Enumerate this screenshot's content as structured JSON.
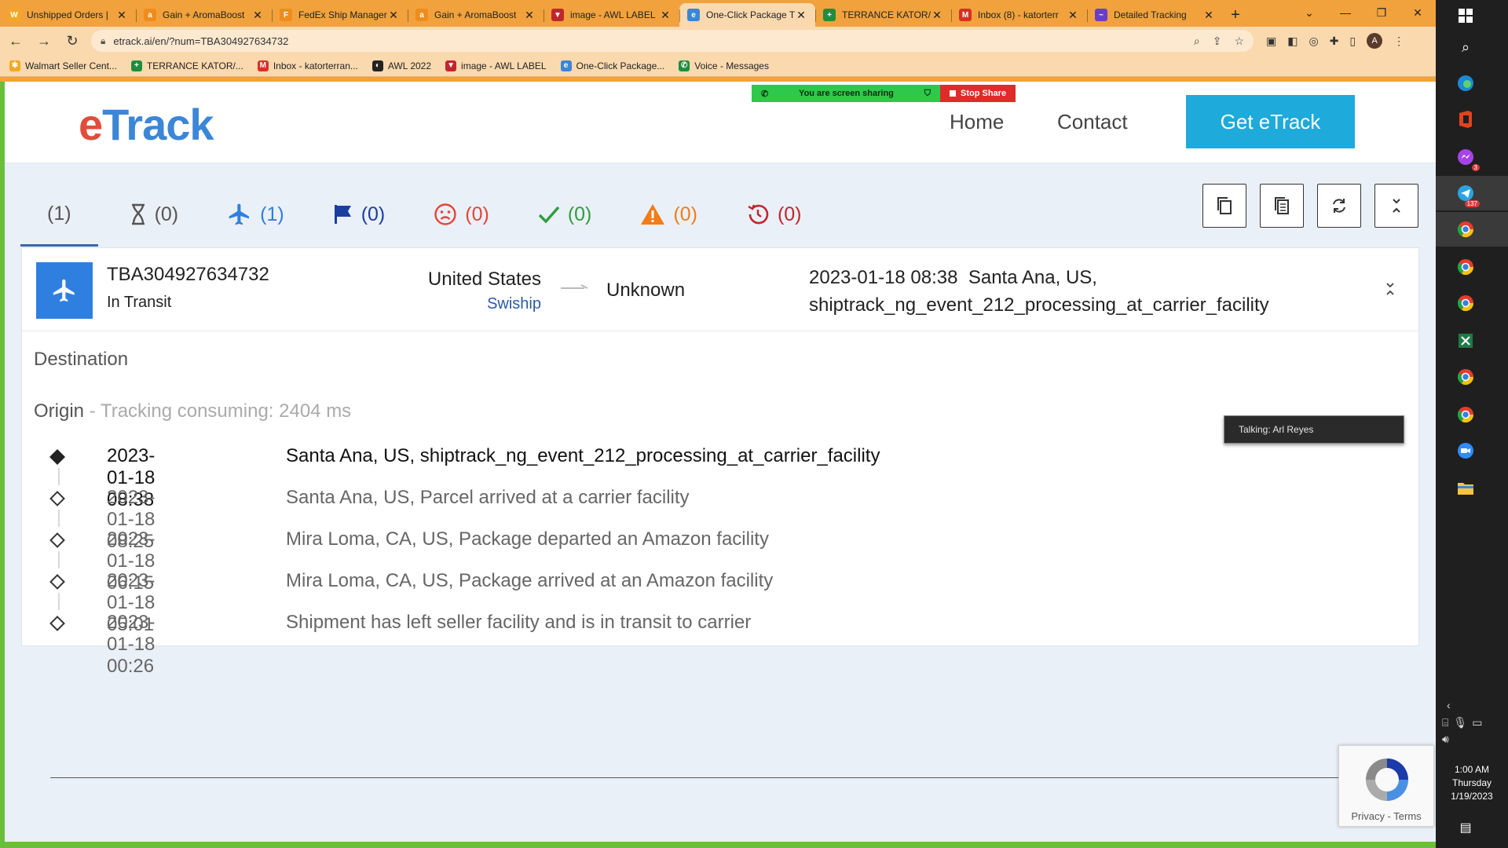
{
  "browser": {
    "tabs": [
      {
        "title": "Unshipped Orders |",
        "fav": "W",
        "fav_color": "#f5a623"
      },
      {
        "title": "Gain + AromaBoost",
        "fav": "a",
        "fav_color": "#f08c1a"
      },
      {
        "title": "FedEx Ship Manager",
        "fav": "F",
        "fav_color": "#f08c1a"
      },
      {
        "title": "Gain + AromaBoost",
        "fav": "a",
        "fav_color": "#f08c1a"
      },
      {
        "title": "image - AWL LABEL",
        "fav": "▼",
        "fav_color": "#c0262d"
      },
      {
        "title": "One-Click Package T",
        "fav": "e",
        "fav_color": "#3b86d6",
        "active": true
      },
      {
        "title": "TERRANCE KATOR/W",
        "fav": "+",
        "fav_color": "#1e8e3e"
      },
      {
        "title": "Inbox (8) - katorterr",
        "fav": "M",
        "fav_color": "#d93025"
      },
      {
        "title": "Detailed Tracking",
        "fav": "~",
        "fav_color": "#6a3dc9"
      }
    ],
    "new_tab": "+",
    "window_controls": {
      "dropdown": "⌄",
      "minimize": "—",
      "restore": "❐",
      "close": "✕"
    },
    "tab_close": "✕",
    "url": "etrack.ai/en/?num=TBA304927634732",
    "avatar": "A",
    "bookmarks": [
      {
        "label": "Walmart Seller Cent...",
        "ic": "✱",
        "ic_color": "#f5a623"
      },
      {
        "label": "TERRANCE KATOR/...",
        "ic": "+",
        "ic_color": "#1e8e3e"
      },
      {
        "label": "Inbox - katorterran...",
        "ic": "M",
        "ic_color": "#d93025"
      },
      {
        "label": "AWL 2022",
        "ic": "◐",
        "ic_color": "#222222"
      },
      {
        "label": "image - AWL LABEL",
        "ic": "▼",
        "ic_color": "#c0262d"
      },
      {
        "label": "One-Click Package...",
        "ic": "e",
        "ic_color": "#3b86d6"
      },
      {
        "label": "Voice - Messages",
        "ic": "✆",
        "ic_color": "#1e8e3e"
      }
    ]
  },
  "screen_share": {
    "message": "You are screen sharing",
    "stop": "Stop Share"
  },
  "site": {
    "logo_e": "e",
    "logo_rest": "Track",
    "nav": {
      "home": "Home",
      "contact": "Contact"
    },
    "cta": "Get eTrack"
  },
  "filters": [
    {
      "icon": "none",
      "count": "(1)",
      "color": "#555555"
    },
    {
      "icon": "hourglass-icon",
      "count": "(0)",
      "color": "#555555"
    },
    {
      "icon": "plane-icon",
      "count": "(1)",
      "color": "#2f7fe0"
    },
    {
      "icon": "flag-icon",
      "count": "(0)",
      "color": "#1a3f9e"
    },
    {
      "icon": "sad-face-icon",
      "count": "(0)",
      "color": "#e2453a"
    },
    {
      "icon": "check-icon",
      "count": "(0)",
      "color": "#2e9e3f"
    },
    {
      "icon": "warning-icon",
      "count": "(0)",
      "color": "#f07c1a"
    },
    {
      "icon": "history-icon",
      "count": "(0)",
      "color": "#c0262d"
    }
  ],
  "shipment": {
    "tracking_number": "TBA304927634732",
    "status": "In Transit",
    "origin_country": "United States",
    "carrier": "Swiship",
    "destination_country": "Unknown",
    "latest_event_time": "2023-01-18 08:38",
    "latest_event_text": "Santa Ana, US, shiptrack_ng_event_212_processing_at_carrier_facility",
    "destination_label": "Destination",
    "origin_label": "Origin",
    "origin_sub": " - Tracking consuming: 2404 ms",
    "events": [
      {
        "time": "2023-01-18 08:38",
        "desc": "Santa Ana, US, shiptrack_ng_event_212_processing_at_carrier_facility"
      },
      {
        "time": "2023-01-18 08:25",
        "desc": "Santa Ana, US, Parcel arrived at a carrier facility"
      },
      {
        "time": "2023-01-18 06:15",
        "desc": "Mira Loma, CA, US, Package departed an Amazon facility"
      },
      {
        "time": "2023-01-18 05:01",
        "desc": "Mira Loma, CA, US, Package arrived at an Amazon facility"
      },
      {
        "time": "2023-01-18 00:26",
        "desc": "Shipment has left seller facility and is in transit to carrier"
      }
    ]
  },
  "talking": "Talking: Arl Reyes",
  "recaptcha": {
    "links": "Privacy - Terms"
  },
  "taskbar": {
    "clock_time": "1:00 AM",
    "clock_day": "Thursday",
    "clock_date": "1/19/2023",
    "messenger_badge": "3",
    "telegram_badge": "137"
  }
}
